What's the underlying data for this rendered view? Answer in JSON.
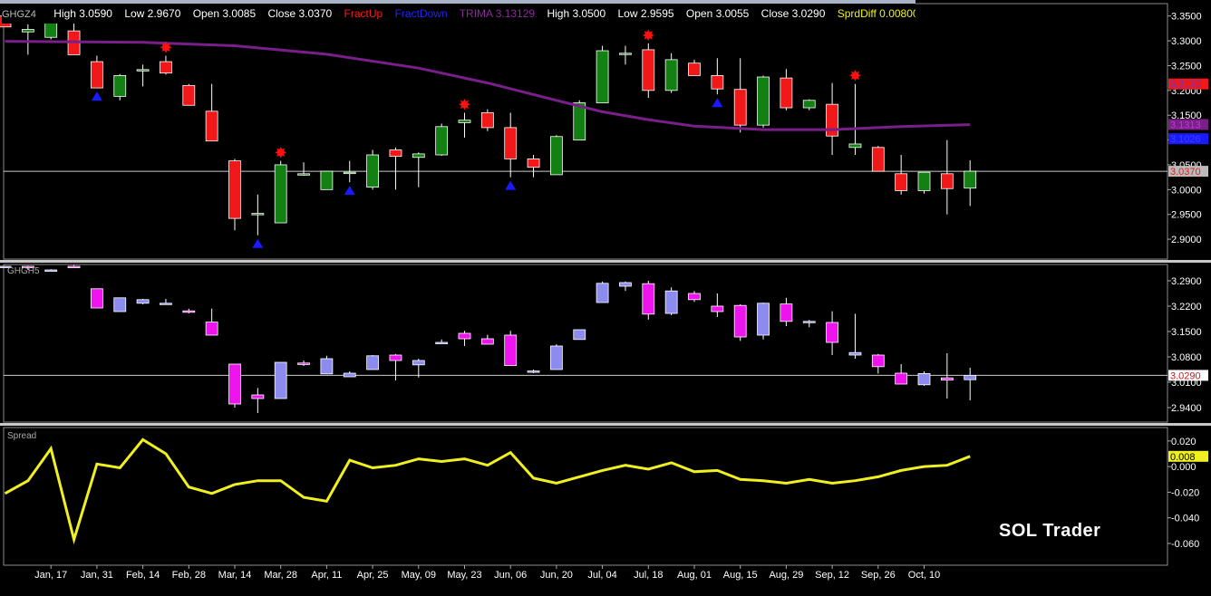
{
  "header": {
    "symbol": "GHGZ4",
    "high": "High 3.0590",
    "low": "Low 2.9670",
    "open": "Open 3.0085",
    "close": "Close 3.0370",
    "fractup": "FractUp",
    "fractdown": "FractDown",
    "trima": "TRIMA  3.13129",
    "high2": "High 3.0500",
    "low2": "Low 2.9595",
    "open2": "Open 3.0055",
    "close2": "Close 3.0290",
    "sprd": "SprdDiff  0.00800"
  },
  "panel2_label": "GHGH5",
  "panel3_label": "Spread",
  "watermark": "SOL Trader",
  "colors": {
    "up": "#128012",
    "down": "#f01818",
    "trima": "#7a1f8a",
    "spread": "#f0f020",
    "up2": "#8c8cf0",
    "down2": "#ee14ee",
    "fractal": "#ff1010",
    "arrow": "#1a1aff"
  },
  "chart_data": [
    {
      "type": "candlestick",
      "title": "GHGZ4",
      "x_labels": [
        "Jan, 17",
        "Jan, 31",
        "Feb, 14",
        "Feb, 28",
        "Mar, 14",
        "Mar, 28",
        "Apr, 11",
        "Apr, 25",
        "May, 09",
        "May, 23",
        "Jun, 06",
        "Jun, 20",
        "Jul, 04",
        "Jul, 18",
        "Aug, 01",
        "Aug, 15",
        "Aug, 29",
        "Sep, 12",
        "Sep, 26",
        "Oct, 10"
      ],
      "y_ticks": [
        "3.3500",
        "3.3000",
        "3.2500",
        "3.2000",
        "3.1500",
        "3.1000",
        "3.0500",
        "3.0000",
        "2.9500",
        "2.9000"
      ],
      "ylim": [
        2.86,
        3.375
      ],
      "last_price": "3.0370",
      "price_tags": [
        {
          "label": "3.2130",
          "value": 3.213,
          "color": "#f01818"
        },
        {
          "label": "3.1313",
          "value": 3.1313,
          "color": "#7a1f8a"
        },
        {
          "label": "3.1026",
          "value": 3.1026,
          "color": "#1a1aff"
        },
        {
          "label": "3.0370",
          "value": 3.037,
          "color": "#bbbbbb"
        }
      ],
      "candles": [
        {
          "o": 3.35,
          "h": 3.352,
          "l": 3.328,
          "c": 3.328
        },
        {
          "o": 3.318,
          "h": 3.333,
          "l": 3.272,
          "c": 3.323
        },
        {
          "o": 3.307,
          "h": 3.337,
          "l": 3.303,
          "c": 3.337
        },
        {
          "o": 3.32,
          "h": 3.337,
          "l": 3.272,
          "c": 3.272
        },
        {
          "o": 3.258,
          "h": 3.27,
          "l": 3.205,
          "c": 3.205
        },
        {
          "o": 3.188,
          "h": 3.233,
          "l": 3.18,
          "c": 3.23
        },
        {
          "o": 3.242,
          "h": 3.252,
          "l": 3.208,
          "c": 3.242
        },
        {
          "o": 3.258,
          "h": 3.27,
          "l": 3.232,
          "c": 3.235
        },
        {
          "o": 3.21,
          "h": 3.213,
          "l": 3.17,
          "c": 3.17
        },
        {
          "o": 3.158,
          "h": 3.213,
          "l": 3.098,
          "c": 3.098
        },
        {
          "o": 3.058,
          "h": 3.062,
          "l": 2.918,
          "c": 2.942
        },
        {
          "o": 2.952,
          "h": 2.99,
          "l": 2.908,
          "c": 2.952
        },
        {
          "o": 2.933,
          "h": 3.058,
          "l": 2.933,
          "c": 3.05
        },
        {
          "o": 3.032,
          "h": 3.055,
          "l": 3.028,
          "c": 3.032
        },
        {
          "o": 3.0,
          "h": 3.037,
          "l": 3.0,
          "c": 3.037
        },
        {
          "o": 3.035,
          "h": 3.058,
          "l": 3.015,
          "c": 3.035
        },
        {
          "o": 3.005,
          "h": 3.08,
          "l": 3.0,
          "c": 3.07
        },
        {
          "o": 3.08,
          "h": 3.085,
          "l": 3.0,
          "c": 3.067
        },
        {
          "o": 3.065,
          "h": 3.075,
          "l": 3.005,
          "c": 3.072
        },
        {
          "o": 3.07,
          "h": 3.133,
          "l": 3.068,
          "c": 3.127
        },
        {
          "o": 3.135,
          "h": 3.155,
          "l": 3.105,
          "c": 3.14
        },
        {
          "o": 3.155,
          "h": 3.162,
          "l": 3.118,
          "c": 3.125
        },
        {
          "o": 3.125,
          "h": 3.155,
          "l": 3.025,
          "c": 3.062
        },
        {
          "o": 3.062,
          "h": 3.07,
          "l": 3.025,
          "c": 3.045
        },
        {
          "o": 3.03,
          "h": 3.11,
          "l": 3.03,
          "c": 3.107
        },
        {
          "o": 3.1,
          "h": 3.18,
          "l": 3.1,
          "c": 3.175
        },
        {
          "o": 3.175,
          "h": 3.29,
          "l": 3.175,
          "c": 3.28
        },
        {
          "o": 3.275,
          "h": 3.29,
          "l": 3.252,
          "c": 3.275
        },
        {
          "o": 3.282,
          "h": 3.295,
          "l": 3.185,
          "c": 3.2
        },
        {
          "o": 3.2,
          "h": 3.275,
          "l": 3.195,
          "c": 3.262
        },
        {
          "o": 3.255,
          "h": 3.262,
          "l": 3.23,
          "c": 3.23
        },
        {
          "o": 3.23,
          "h": 3.265,
          "l": 3.192,
          "c": 3.203
        },
        {
          "o": 3.202,
          "h": 3.265,
          "l": 3.115,
          "c": 3.13
        },
        {
          "o": 3.13,
          "h": 3.23,
          "l": 3.125,
          "c": 3.227
        },
        {
          "o": 3.225,
          "h": 3.243,
          "l": 3.16,
          "c": 3.165
        },
        {
          "o": 3.165,
          "h": 3.182,
          "l": 3.16,
          "c": 3.18
        },
        {
          "o": 3.172,
          "h": 3.215,
          "l": 3.07,
          "c": 3.108
        },
        {
          "o": 3.085,
          "h": 3.213,
          "l": 3.07,
          "c": 3.092
        },
        {
          "o": 3.085,
          "h": 3.088,
          "l": 3.037,
          "c": 3.037
        },
        {
          "o": 3.032,
          "h": 3.07,
          "l": 2.99,
          "c": 2.998
        },
        {
          "o": 2.998,
          "h": 3.035,
          "l": 2.992,
          "c": 3.035
        },
        {
          "o": 3.032,
          "h": 3.1,
          "l": 2.95,
          "c": 3.002
        },
        {
          "o": 3.003,
          "h": 3.059,
          "l": 2.967,
          "c": 3.037
        }
      ],
      "fractal_up": [
        7,
        12,
        20,
        28,
        37
      ],
      "fractal_down": [
        4,
        11,
        15,
        22,
        31
      ],
      "trima": [
        [
          0,
          3.299
        ],
        [
          6,
          3.297
        ],
        [
          10,
          3.29
        ],
        [
          14,
          3.273
        ],
        [
          18,
          3.245
        ],
        [
          21,
          3.215
        ],
        [
          24,
          3.18
        ],
        [
          26,
          3.157
        ],
        [
          28,
          3.141
        ],
        [
          30,
          3.128
        ],
        [
          33,
          3.121
        ],
        [
          36,
          3.121
        ],
        [
          39,
          3.127
        ],
        [
          42,
          3.131
        ]
      ]
    },
    {
      "type": "candlestick",
      "title": "GHGH5",
      "y_ticks": [
        "3.2900",
        "3.2200",
        "3.1500",
        "3.0800",
        "3.0100",
        "2.9400"
      ],
      "ylim": [
        2.9,
        3.335
      ],
      "last_price": "3.0290",
      "candles": [
        {
          "o": 3.33,
          "h": 3.33,
          "l": 3.328,
          "c": 3.33
        },
        {
          "o": 3.33,
          "h": 3.332,
          "l": 3.32,
          "c": 3.328
        },
        {
          "o": 3.32,
          "h": 3.322,
          "l": 3.318,
          "c": 3.32
        },
        {
          "o": 3.33,
          "h": 3.333,
          "l": 3.326,
          "c": 3.326
        },
        {
          "o": 3.268,
          "h": 3.268,
          "l": 3.215,
          "c": 3.215
        },
        {
          "o": 3.205,
          "h": 3.243,
          "l": 3.205,
          "c": 3.243
        },
        {
          "o": 3.228,
          "h": 3.24,
          "l": 3.225,
          "c": 3.238
        },
        {
          "o": 3.228,
          "h": 3.24,
          "l": 3.225,
          "c": 3.228
        },
        {
          "o": 3.207,
          "h": 3.213,
          "l": 3.2,
          "c": 3.203
        },
        {
          "o": 3.176,
          "h": 3.213,
          "l": 3.14,
          "c": 3.14
        },
        {
          "o": 3.06,
          "h": 3.06,
          "l": 2.94,
          "c": 2.95
        },
        {
          "o": 2.975,
          "h": 2.994,
          "l": 2.925,
          "c": 2.965
        },
        {
          "o": 2.965,
          "h": 3.065,
          "l": 2.965,
          "c": 3.065
        },
        {
          "o": 3.063,
          "h": 3.07,
          "l": 3.055,
          "c": 3.059
        },
        {
          "o": 3.033,
          "h": 3.083,
          "l": 3.033,
          "c": 3.075
        },
        {
          "o": 3.025,
          "h": 3.04,
          "l": 3.025,
          "c": 3.035
        },
        {
          "o": 3.045,
          "h": 3.085,
          "l": 3.045,
          "c": 3.083
        },
        {
          "o": 3.085,
          "h": 3.088,
          "l": 3.015,
          "c": 3.07
        },
        {
          "o": 3.058,
          "h": 3.075,
          "l": 3.023,
          "c": 3.07
        },
        {
          "o": 3.12,
          "h": 3.128,
          "l": 3.118,
          "c": 3.12
        },
        {
          "o": 3.145,
          "h": 3.152,
          "l": 3.11,
          "c": 3.13
        },
        {
          "o": 3.13,
          "h": 3.141,
          "l": 3.128,
          "c": 3.115
        },
        {
          "o": 3.14,
          "h": 3.152,
          "l": 3.056,
          "c": 3.056
        },
        {
          "o": 3.041,
          "h": 3.045,
          "l": 3.035,
          "c": 3.041
        },
        {
          "o": 3.045,
          "h": 3.115,
          "l": 3.045,
          "c": 3.11
        },
        {
          "o": 3.128,
          "h": 3.155,
          "l": 3.128,
          "c": 3.155
        },
        {
          "o": 3.23,
          "h": 3.288,
          "l": 3.23,
          "c": 3.283
        },
        {
          "o": 3.275,
          "h": 3.288,
          "l": 3.262,
          "c": 3.285
        },
        {
          "o": 3.282,
          "h": 3.29,
          "l": 3.183,
          "c": 3.198
        },
        {
          "o": 3.2,
          "h": 3.272,
          "l": 3.195,
          "c": 3.262
        },
        {
          "o": 3.255,
          "h": 3.262,
          "l": 3.232,
          "c": 3.238
        },
        {
          "o": 3.22,
          "h": 3.255,
          "l": 3.19,
          "c": 3.205
        },
        {
          "o": 3.222,
          "h": 3.225,
          "l": 3.124,
          "c": 3.135
        },
        {
          "o": 3.14,
          "h": 3.23,
          "l": 3.128,
          "c": 3.228
        },
        {
          "o": 3.226,
          "h": 3.243,
          "l": 3.165,
          "c": 3.178
        },
        {
          "o": 3.178,
          "h": 3.182,
          "l": 3.162,
          "c": 3.178
        },
        {
          "o": 3.175,
          "h": 3.206,
          "l": 3.085,
          "c": 3.12
        },
        {
          "o": 3.085,
          "h": 3.199,
          "l": 3.075,
          "c": 3.092
        },
        {
          "o": 3.085,
          "h": 3.088,
          "l": 3.034,
          "c": 3.053
        },
        {
          "o": 3.035,
          "h": 3.06,
          "l": 3.005,
          "c": 3.005
        },
        {
          "o": 3.003,
          "h": 3.04,
          "l": 3.0,
          "c": 3.034
        },
        {
          "o": 3.022,
          "h": 3.09,
          "l": 2.965,
          "c": 3.016
        },
        {
          "o": 3.017,
          "h": 3.05,
          "l": 2.96,
          "c": 3.029
        }
      ]
    },
    {
      "type": "line",
      "title": "Spread",
      "y_ticks": [
        "0.020",
        "0.000",
        "-0.020",
        "-0.040",
        "-0.060"
      ],
      "ylim": [
        -0.077,
        0.0305
      ],
      "last_value": "0.008",
      "points": [
        [
          0,
          -0.021
        ],
        [
          1,
          -0.011
        ],
        [
          2,
          0.014
        ],
        [
          3,
          -0.057
        ],
        [
          4,
          0.002
        ],
        [
          5,
          -0.001
        ],
        [
          6,
          0.021
        ],
        [
          7,
          0.01
        ],
        [
          8,
          -0.016
        ],
        [
          9,
          -0.021
        ],
        [
          10,
          -0.014
        ],
        [
          11,
          -0.011
        ],
        [
          12,
          -0.011
        ],
        [
          13,
          -0.024
        ],
        [
          14,
          -0.027
        ],
        [
          15,
          0.005
        ],
        [
          16,
          -0.001
        ],
        [
          17,
          0.001
        ],
        [
          18,
          0.006
        ],
        [
          19,
          0.004
        ],
        [
          20,
          0.006
        ],
        [
          21,
          0.001
        ],
        [
          22,
          0.011
        ],
        [
          23,
          -0.009
        ],
        [
          24,
          -0.013
        ],
        [
          25,
          -0.008
        ],
        [
          26,
          -0.003
        ],
        [
          27,
          0.001
        ],
        [
          28,
          -0.002
        ],
        [
          29,
          0.003
        ],
        [
          30,
          -0.004
        ],
        [
          31,
          -0.003
        ],
        [
          32,
          -0.01
        ],
        [
          33,
          -0.011
        ],
        [
          34,
          -0.013
        ],
        [
          35,
          -0.01
        ],
        [
          36,
          -0.013
        ],
        [
          37,
          -0.011
        ],
        [
          38,
          -0.008
        ],
        [
          39,
          -0.003
        ],
        [
          40,
          0.0
        ],
        [
          41,
          0.001
        ],
        [
          42,
          0.008
        ]
      ]
    }
  ]
}
